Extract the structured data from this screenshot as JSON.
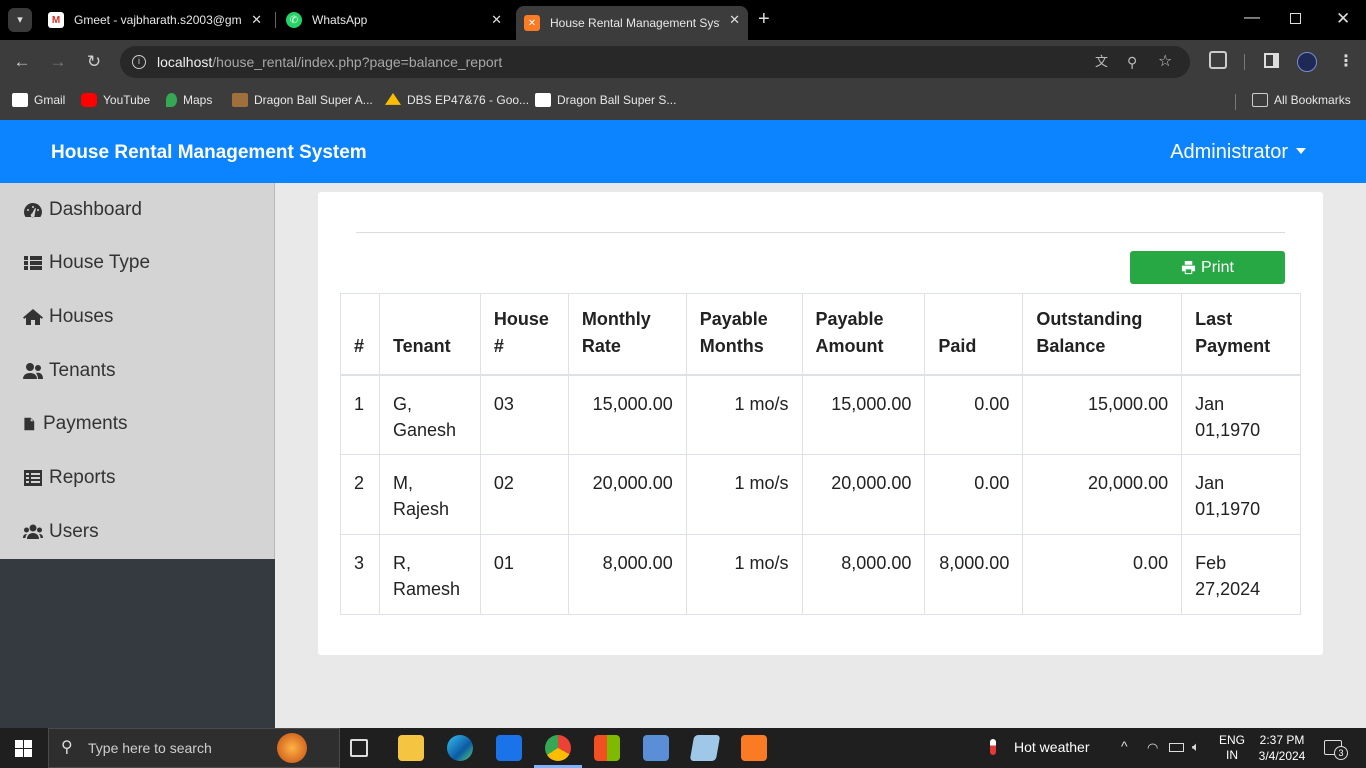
{
  "browser": {
    "tabs": [
      {
        "title": "Gmeet - vajbharath.s2003@gma",
        "active": false
      },
      {
        "title": "WhatsApp",
        "active": false
      },
      {
        "title": "House Rental Management Syst",
        "active": true
      }
    ],
    "url_host": "localhost",
    "url_path": "/house_rental/index.php?page=balance_report",
    "bookmarks": [
      "Gmail",
      "YouTube",
      "Maps",
      "Dragon Ball Super A...",
      "DBS EP47&76 - Goo...",
      "Dragon Ball Super S..."
    ],
    "all_bookmarks": "All Bookmarks"
  },
  "app": {
    "title": "House Rental Management System",
    "user_menu": "Administrator"
  },
  "sidebar": {
    "items": [
      {
        "label": "Dashboard",
        "icon": "dashboard-icon"
      },
      {
        "label": "House Type",
        "icon": "list-icon"
      },
      {
        "label": "Houses",
        "icon": "home-icon"
      },
      {
        "label": "Tenants",
        "icon": "user-group-icon"
      },
      {
        "label": "Payments",
        "icon": "file-icon"
      },
      {
        "label": "Reports",
        "icon": "list-alt-icon"
      },
      {
        "label": "Users",
        "icon": "users-icon"
      }
    ]
  },
  "report": {
    "print_label": "Print",
    "columns": [
      "#",
      "Tenant",
      "House #",
      "Monthly Rate",
      "Payable Months",
      "Payable Amount",
      "Paid",
      "Outstanding Balance",
      "Last Payment"
    ],
    "rows": [
      [
        "1",
        "G, Ganesh",
        "03",
        "15,000.00",
        "1 mo/s",
        "15,000.00",
        "0.00",
        "15,000.00",
        "Jan 01,1970"
      ],
      [
        "2",
        "M, Rajesh",
        "02",
        "20,000.00",
        "1 mo/s",
        "20,000.00",
        "0.00",
        "20,000.00",
        "Jan 01,1970"
      ],
      [
        "3",
        "R, Ramesh",
        "01",
        "8,000.00",
        "1 mo/s",
        "8,000.00",
        "8,000.00",
        "0.00",
        "Feb 27,2024"
      ]
    ]
  },
  "taskbar": {
    "search_placeholder": "Type here to search",
    "weather": "Hot weather",
    "lang_top": "ENG",
    "lang_bottom": "IN",
    "time": "2:37 PM",
    "date": "3/4/2024",
    "notifications": "3"
  },
  "colors": {
    "header": "#0d84ff",
    "print_button": "#28a745",
    "sidebar_dark": "#343a40"
  }
}
